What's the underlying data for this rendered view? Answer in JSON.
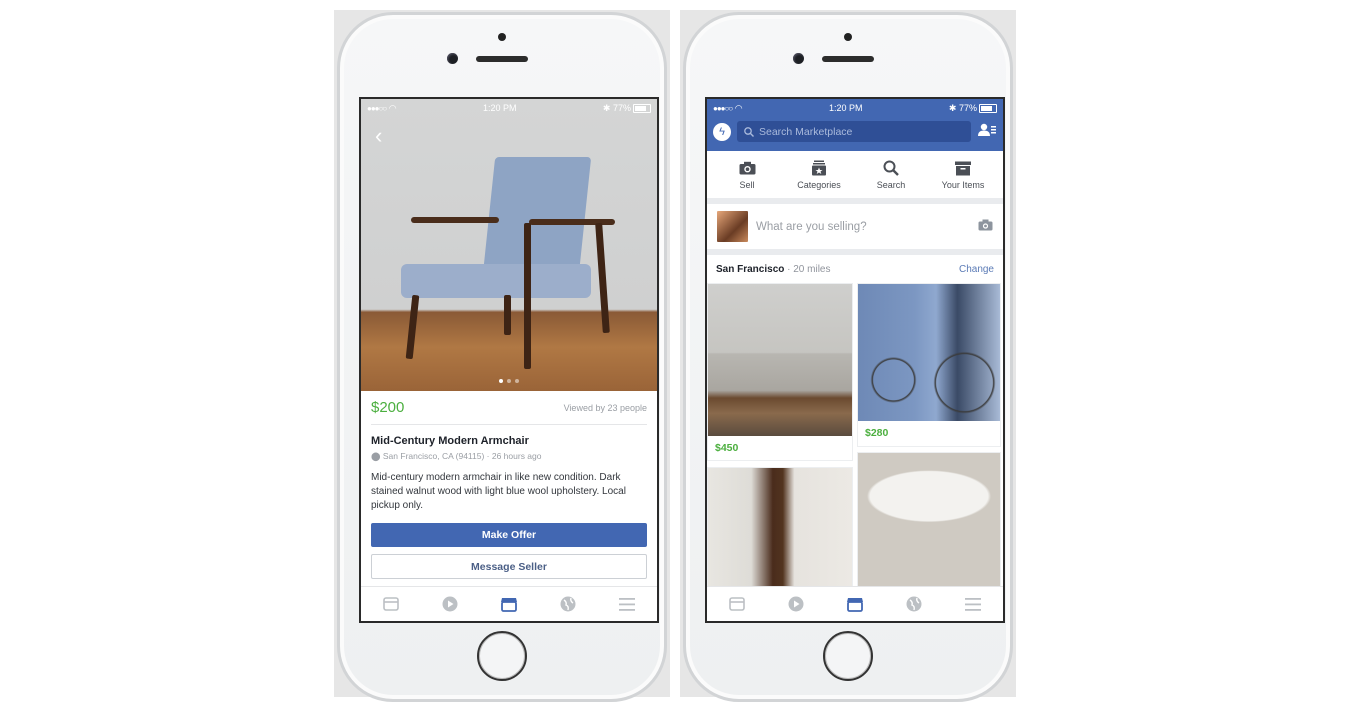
{
  "left_phone": {
    "status": {
      "signal": "●●●○○",
      "wifi_icon": "wifi-icon",
      "time": "1:20 PM",
      "bluetooth_icon": "bluetooth-icon",
      "battery": "77%"
    },
    "listing": {
      "price": "$200",
      "views": "Viewed by 23 people",
      "title": "Mid-Century Modern Armchair",
      "location": "San Francisco, CA (94115) · 26 hours ago",
      "description": "Mid-century modern armchair in like new condition. Dark stained walnut wood with light blue wool upholstery. Local pickup only.",
      "photo_index": 1,
      "photo_count": 3
    },
    "buttons": {
      "make_offer": "Make Offer",
      "message_seller": "Message Seller"
    }
  },
  "right_phone": {
    "status": {
      "signal": "●●●○○",
      "time": "1:20 PM",
      "battery": "77%"
    },
    "search": {
      "placeholder": "Search Marketplace"
    },
    "shortcuts": [
      {
        "label": "Sell",
        "icon": "camera-icon"
      },
      {
        "label": "Categories",
        "icon": "categories-icon"
      },
      {
        "label": "Search",
        "icon": "search-icon"
      },
      {
        "label": "Your Items",
        "icon": "box-icon"
      }
    ],
    "composer": {
      "placeholder": "What are you selling?"
    },
    "location": {
      "city": "San Francisco",
      "distance": " · 20 miles",
      "change": "Change"
    },
    "items": [
      {
        "price": "$450",
        "subject": "sofa"
      },
      {
        "price": "$280",
        "subject": "bicycle"
      },
      {
        "price": "",
        "subject": "coffee maker"
      },
      {
        "price": "",
        "subject": "round table"
      }
    ]
  },
  "tabbar": [
    "news-feed-icon",
    "video-icon",
    "marketplace-icon",
    "globe-icon",
    "menu-icon"
  ],
  "colors": {
    "brand": "#4267b2",
    "price": "#4caf3f",
    "active_tab": "#4267b2",
    "inactive_tab": "#bcc0c4"
  }
}
